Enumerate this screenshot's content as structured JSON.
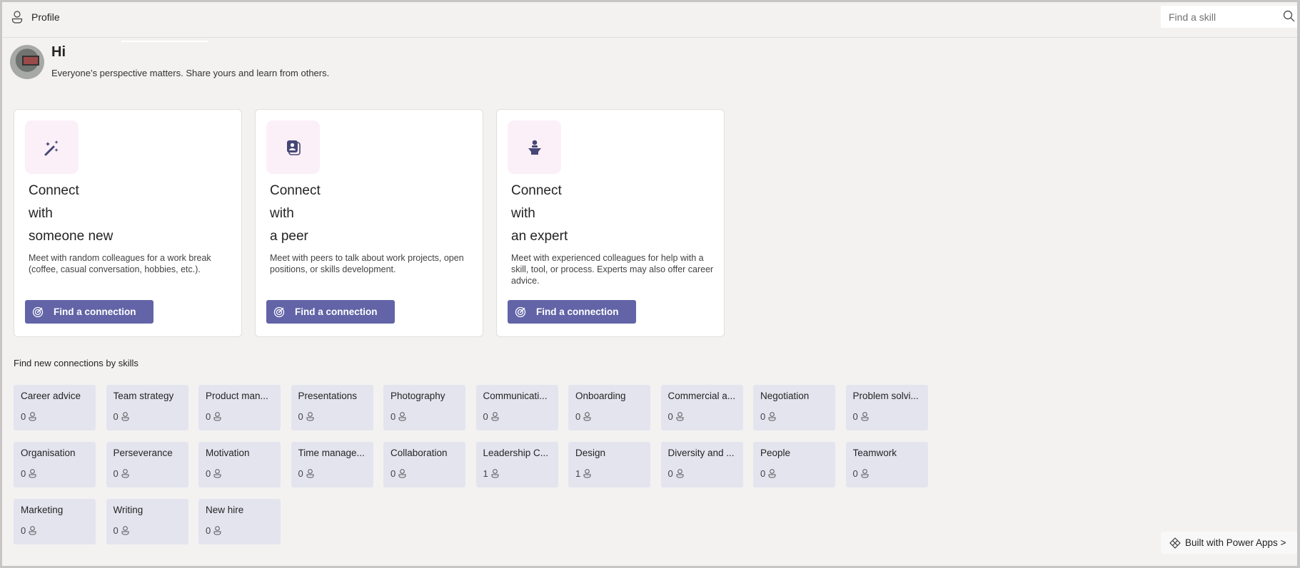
{
  "header": {
    "profile_label": "Profile",
    "search_placeholder": "Find a skill"
  },
  "greeting": {
    "title": "Hi",
    "subtitle": "Everyone’s perspective matters. Share yours and learn from others."
  },
  "cards": [
    {
      "icon": "magic-wand-icon",
      "line1": "Connect",
      "line2": "with",
      "line3": "someone new",
      "description": "Meet with random colleagues for a work break (coffee, casual conversation, hobbies, etc.).",
      "button": "Find a connection"
    },
    {
      "icon": "contact-card-icon",
      "line1": "Connect",
      "line2": "with",
      "line3": "a peer",
      "description": "Meet with peers to talk about work projects, open positions, or skills development.",
      "button": "Find a connection"
    },
    {
      "icon": "presenter-icon",
      "line1": "Connect",
      "line2": "with",
      "line3": "an expert",
      "description": "Meet with experienced colleagues for help with a skill, tool, or process. Experts may also offer career advice.",
      "button": "Find a connection"
    }
  ],
  "skills_heading": "Find new connections by skills",
  "skills": [
    {
      "name": "Career advice",
      "count": "0"
    },
    {
      "name": "Team strategy",
      "count": "0"
    },
    {
      "name": "Product man...",
      "count": "0"
    },
    {
      "name": "Presentations",
      "count": "0"
    },
    {
      "name": "Photography",
      "count": "0"
    },
    {
      "name": "Communicati...",
      "count": "0"
    },
    {
      "name": "Onboarding",
      "count": "0"
    },
    {
      "name": "Commercial a...",
      "count": "0"
    },
    {
      "name": "Negotiation",
      "count": "0"
    },
    {
      "name": "Problem solvi...",
      "count": "0"
    },
    {
      "name": "Organisation",
      "count": "0"
    },
    {
      "name": "Perseverance",
      "count": "0"
    },
    {
      "name": "Motivation",
      "count": "0"
    },
    {
      "name": "Time manage...",
      "count": "0"
    },
    {
      "name": "Collaboration",
      "count": "0"
    },
    {
      "name": "Leadership C...",
      "count": "1"
    },
    {
      "name": "Design",
      "count": "1"
    },
    {
      "name": "Diversity and ...",
      "count": "0"
    },
    {
      "name": "People",
      "count": "0"
    },
    {
      "name": "Teamwork",
      "count": "0"
    },
    {
      "name": "Marketing",
      "count": "0"
    },
    {
      "name": "Writing",
      "count": "0"
    },
    {
      "name": "New hire",
      "count": "0"
    }
  ],
  "footer": {
    "badge": "Built with Power Apps >"
  },
  "colors": {
    "accent": "#6264a7",
    "icon": "#464775",
    "tile": "#e4e4ef",
    "icon_bg": "#fbf0f8",
    "background": "#f3f2f1"
  }
}
